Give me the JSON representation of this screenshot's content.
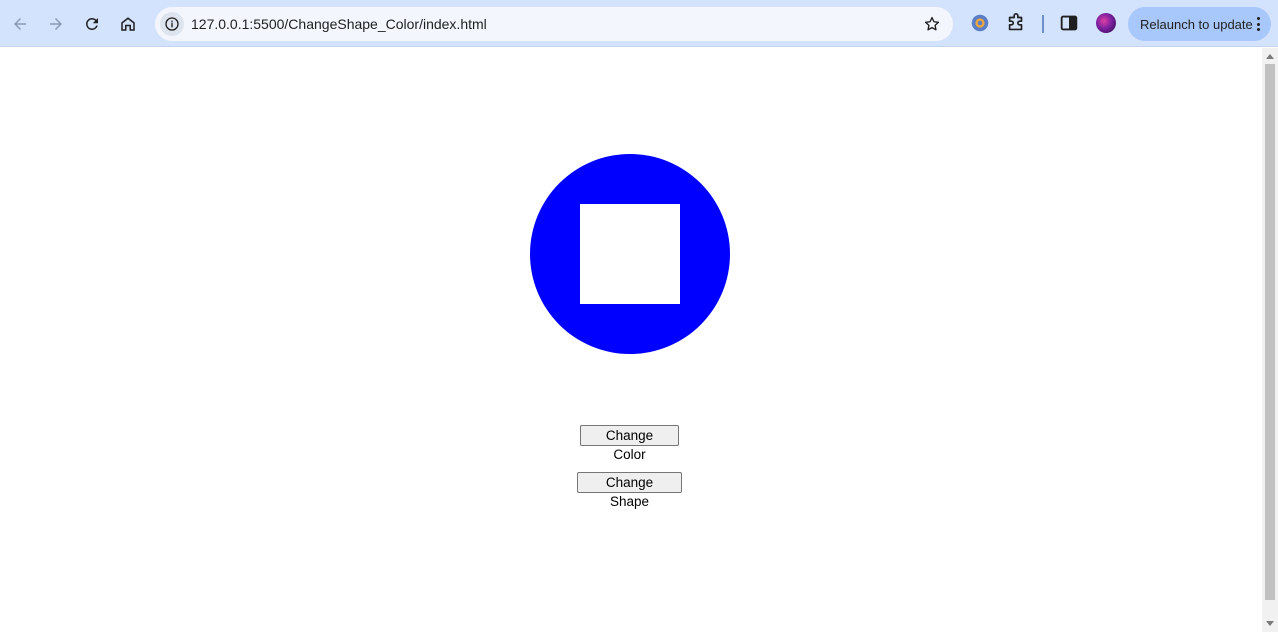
{
  "browser": {
    "url": "127.0.0.1:5500/ChangeShape_Color/index.html",
    "relaunch_label": "Relaunch to update"
  },
  "page": {
    "shape": {
      "outer": "circle",
      "inner": "square",
      "color": "#0000ff"
    },
    "buttons": {
      "change_color": "Change Color",
      "change_shape": "Change Shape"
    }
  }
}
